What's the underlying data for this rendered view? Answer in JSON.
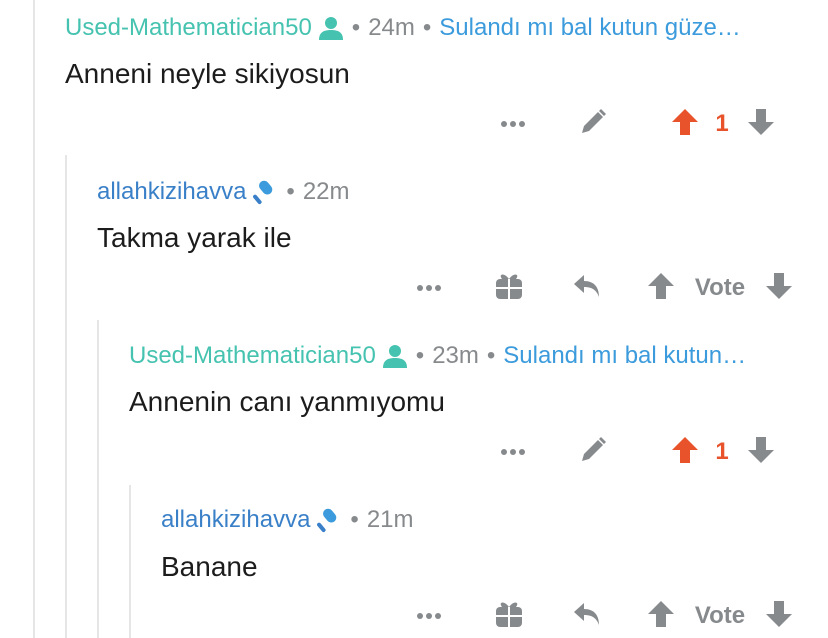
{
  "colors": {
    "op_author": "#46c3b0",
    "author": "#3a80c8",
    "context_link": "#3b9bdc",
    "meta_gray": "#878a8c",
    "upvote_active": "#e8532b",
    "icon_gray": "#878a8c",
    "thread_line": "#e6e6e6"
  },
  "comments": [
    {
      "author": "Used-Mathematician50",
      "flair_icon": "person-icon",
      "separator": "•",
      "time": "24m",
      "context": "Sulandı mı bal kutun güze…",
      "body": "Anneni neyle sikiyosun",
      "actions": {
        "more": "more-icon",
        "edit": "pencil-icon",
        "upvoted": true,
        "score": "1"
      }
    },
    {
      "author": "allahkizihavva",
      "flair_icon": "microphone-icon",
      "separator": "•",
      "time": "22m",
      "body": "Takma yarak ile",
      "actions": {
        "more": "more-icon",
        "award": "gift-icon",
        "reply": "reply-icon",
        "vote_label": "Vote"
      }
    },
    {
      "author": "Used-Mathematician50",
      "flair_icon": "person-icon",
      "separator": "•",
      "time": "23m",
      "context": "Sulandı mı bal kutun…",
      "body": "Annenin canı yanmıyomu",
      "actions": {
        "more": "more-icon",
        "edit": "pencil-icon",
        "upvoted": true,
        "score": "1"
      }
    },
    {
      "author": "allahkizihavva",
      "flair_icon": "microphone-icon",
      "separator": "•",
      "time": "21m",
      "body": "Banane",
      "actions": {
        "more": "more-icon",
        "award": "gift-icon",
        "reply": "reply-icon",
        "vote_label": "Vote"
      }
    }
  ]
}
